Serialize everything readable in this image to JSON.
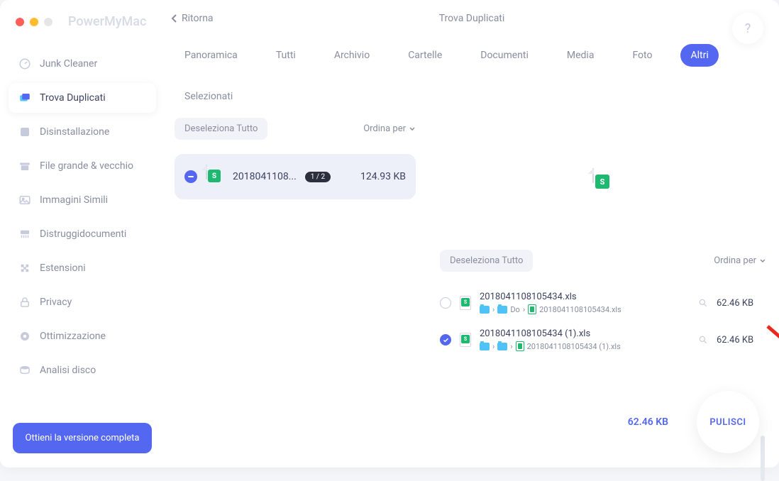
{
  "brand": "PowerMyMac",
  "header": {
    "back": "Ritorna",
    "title": "Trova Duplicati",
    "help": "?"
  },
  "sidebar": {
    "items": [
      {
        "label": "Junk Cleaner"
      },
      {
        "label": "Trova Duplicati"
      },
      {
        "label": "Disinstallazione"
      },
      {
        "label": "File grande & vecchio"
      },
      {
        "label": "Immagini Simili"
      },
      {
        "label": "Distruggidocumenti"
      },
      {
        "label": "Estensioni"
      },
      {
        "label": "Privacy"
      },
      {
        "label": "Ottimizzazione"
      },
      {
        "label": "Analisi disco"
      }
    ],
    "cta": "Ottieni la versione completa"
  },
  "tabs": [
    "Panoramica",
    "Tutti",
    "Archivio",
    "Cartelle",
    "Documenti",
    "Media",
    "Foto",
    "Altri",
    "Selezionati"
  ],
  "active_tab_index": 7,
  "left": {
    "deselect": "Deseleziona Tutto",
    "sort": "Ordina per",
    "group": {
      "name": "2018041108...",
      "count": "1 / 2",
      "size": "124.93 KB",
      "icon_letter": "S"
    }
  },
  "right": {
    "deselect": "Deseleziona Tutto",
    "sort": "Ordina per",
    "preview_icon_letter": "S",
    "files": [
      {
        "selected": false,
        "name": "2018041108105434.xls",
        "path_mid": "Do",
        "path_tail": "2018041108105434.xls",
        "size": "62.46 KB"
      },
      {
        "selected": true,
        "name": "2018041108105434 (1).xls",
        "path_mid": "",
        "path_tail": "2018041108105434 (1).xls",
        "size": "62.46 KB"
      }
    ]
  },
  "footer": {
    "total": "62.46 KB",
    "clean": "PULISCI"
  }
}
